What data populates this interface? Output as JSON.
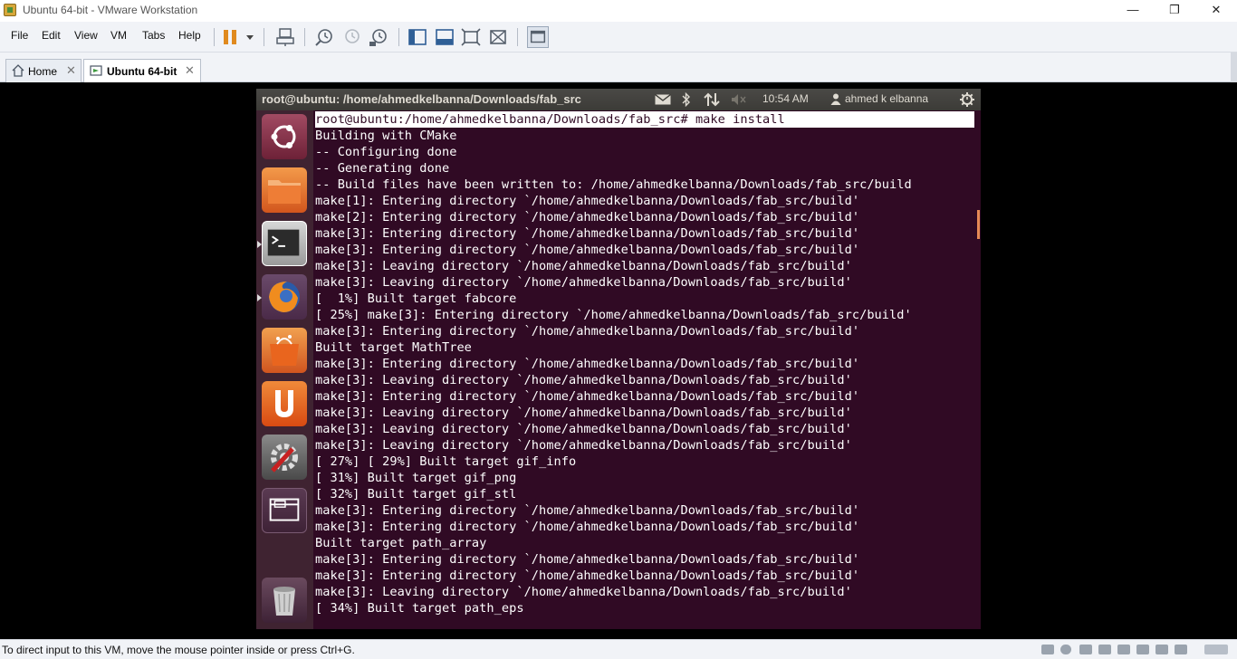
{
  "window": {
    "title": "Ubuntu 64-bit - VMware Workstation",
    "minimize": "—",
    "restore": "❐",
    "close": "✕"
  },
  "menu": [
    "File",
    "Edit",
    "View",
    "VM",
    "Tabs",
    "Help"
  ],
  "tabs": [
    {
      "label": "Home",
      "close": "✕"
    },
    {
      "label": "Ubuntu 64-bit",
      "close": "✕"
    }
  ],
  "ubuntu": {
    "window_title": "root@ubuntu: /home/ahmedkelbanna/Downloads/fab_src",
    "time": "10:54 AM",
    "user": "ahmed k elbanna"
  },
  "terminal": {
    "lines": [
      "root@ubuntu:/home/ahmedkelbanna/Downloads/fab_src# make install",
      "Building with CMake",
      "-- Configuring done",
      "-- Generating done",
      "-- Build files have been written to: /home/ahmedkelbanna/Downloads/fab_src/build",
      "make[1]: Entering directory `/home/ahmedkelbanna/Downloads/fab_src/build'",
      "make[2]: Entering directory `/home/ahmedkelbanna/Downloads/fab_src/build'",
      "make[3]: Entering directory `/home/ahmedkelbanna/Downloads/fab_src/build'",
      "make[3]: Entering directory `/home/ahmedkelbanna/Downloads/fab_src/build'",
      "make[3]: Leaving directory `/home/ahmedkelbanna/Downloads/fab_src/build'",
      "make[3]: Leaving directory `/home/ahmedkelbanna/Downloads/fab_src/build'",
      "[  1%] Built target fabcore",
      "[ 25%] make[3]: Entering directory `/home/ahmedkelbanna/Downloads/fab_src/build'",
      "make[3]: Entering directory `/home/ahmedkelbanna/Downloads/fab_src/build'",
      "Built target MathTree",
      "make[3]: Entering directory `/home/ahmedkelbanna/Downloads/fab_src/build'",
      "make[3]: Leaving directory `/home/ahmedkelbanna/Downloads/fab_src/build'",
      "make[3]: Entering directory `/home/ahmedkelbanna/Downloads/fab_src/build'",
      "make[3]: Leaving directory `/home/ahmedkelbanna/Downloads/fab_src/build'",
      "make[3]: Leaving directory `/home/ahmedkelbanna/Downloads/fab_src/build'",
      "make[3]: Leaving directory `/home/ahmedkelbanna/Downloads/fab_src/build'",
      "[ 27%] [ 29%] Built target gif_info",
      "[ 31%] Built target gif_png",
      "[ 32%] Built target gif_stl",
      "make[3]: Entering directory `/home/ahmedkelbanna/Downloads/fab_src/build'",
      "make[3]: Entering directory `/home/ahmedkelbanna/Downloads/fab_src/build'",
      "Built target path_array",
      "make[3]: Entering directory `/home/ahmedkelbanna/Downloads/fab_src/build'",
      "make[3]: Entering directory `/home/ahmedkelbanna/Downloads/fab_src/build'",
      "make[3]: Leaving directory `/home/ahmedkelbanna/Downloads/fab_src/build'",
      "[ 34%] Built target path_eps"
    ]
  },
  "status": {
    "message": "To direct input to this VM, move the mouse pointer inside or press Ctrl+G."
  },
  "colors": {
    "terminal_bg": "#300a24",
    "launcher_bg": "#3f2331",
    "pause_orange": "#e08a1e"
  }
}
